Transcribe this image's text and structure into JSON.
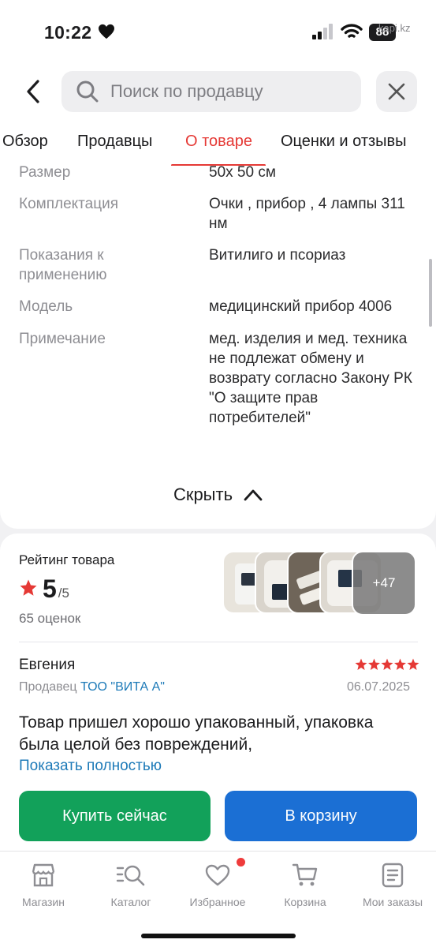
{
  "status": {
    "time": "10:22",
    "battery": "88",
    "watermark": "kapi.kz"
  },
  "search": {
    "placeholder": "Поиск по продавцу"
  },
  "tabs": [
    {
      "label": "Обзор"
    },
    {
      "label": "Продавцы"
    },
    {
      "label": "О товаре",
      "active": true
    },
    {
      "label": "Оценки и отзывы"
    }
  ],
  "specs": [
    {
      "key": "Размер",
      "value": "50x 50 см"
    },
    {
      "key": "Комплектация",
      "value": "Очки , прибор , 4 лампы 311 нм"
    },
    {
      "key": "Показания к применению",
      "value": "Витилиго и псориаз"
    },
    {
      "key": "Модель",
      "value": "медицинский прибор 4006"
    },
    {
      "key": "Примечание",
      "value": "мед. изделия и мед. техника не подлежат обмену и возврату согласно Закону РК \"О защите прав потребителей\""
    }
  ],
  "hide_label": "Скрыть",
  "rating": {
    "title": "Рейтинг товара",
    "score": "5",
    "out_of": "/5",
    "count": "65 оценок",
    "more_photos": "+47"
  },
  "review": {
    "author": "Евгения",
    "seller_prefix": "Продавец",
    "seller_name": "ТОО \"ВИТА А\"",
    "date": "06.07.2025",
    "stars": 5,
    "text": "Товар пришел хорошо упакованный, упаковка была целой без повреждений,",
    "show_more": "Показать полностью"
  },
  "actions": {
    "buy_now": "Купить сейчас",
    "to_cart": "В корзину"
  },
  "nav": [
    {
      "label": "Магазин",
      "icon": "shop-icon"
    },
    {
      "label": "Каталог",
      "icon": "catalog-search-icon"
    },
    {
      "label": "Избранное",
      "icon": "heart-icon"
    },
    {
      "label": "Корзина",
      "icon": "cart-icon"
    },
    {
      "label": "Мои заказы",
      "icon": "orders-icon"
    }
  ],
  "colors": {
    "accent_red": "#e53935",
    "buy_green": "#12a15a",
    "cart_blue": "#1b6fd4",
    "link_blue": "#1d7ab8"
  }
}
